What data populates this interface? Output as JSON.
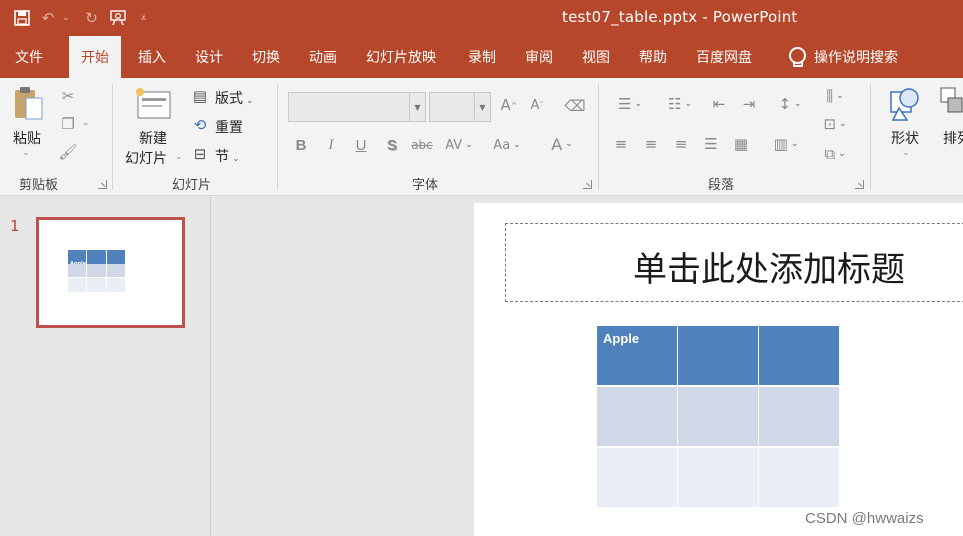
{
  "window": {
    "title": "test07_table.pptx  -  PowerPoint"
  },
  "qat": {
    "save_icon": "save-icon",
    "undo_icon": "undo-icon",
    "redo_icon": "redo-icon",
    "present_icon": "present-from-start-icon",
    "customize_icon": "customize-qat-icon"
  },
  "tabs": [
    "文件",
    "开始",
    "插入",
    "设计",
    "切换",
    "动画",
    "幻灯片放映",
    "录制",
    "审阅",
    "视图",
    "帮助",
    "百度网盘"
  ],
  "active_tab": "开始",
  "tell_me": "操作说明搜索",
  "ribbon": {
    "clipboard": {
      "paste": "粘贴",
      "label": "剪贴板"
    },
    "slides": {
      "new_slide_line1": "新建",
      "new_slide_line2": "幻灯片",
      "layout": "版式",
      "reset": "重置",
      "section": "节",
      "label": "幻灯片"
    },
    "font": {
      "bold": "B",
      "italic": "I",
      "underline": "U",
      "shadow": "S",
      "strike": "abc",
      "spacing": "AV",
      "case": "Aa",
      "color": "A",
      "grow": "A",
      "shrink": "A",
      "label": "字体"
    },
    "paragraph": {
      "label": "段落"
    },
    "drawing": {
      "shapes": "形状",
      "arrange": "排列"
    }
  },
  "slide_panel": {
    "slide_number": "1",
    "thumb_text": "Apple"
  },
  "slide": {
    "title_placeholder": "单击此处添加标题",
    "table": {
      "rows": [
        [
          "Apple",
          "",
          ""
        ],
        [
          "",
          "",
          ""
        ],
        [
          "",
          "",
          ""
        ]
      ]
    }
  },
  "colors": {
    "accent": "#b7472a",
    "table_header": "#4f81bd",
    "table_band1": "#d0d8e8",
    "table_band2": "#e9edf4"
  },
  "watermark": "CSDN @hwwaizs"
}
